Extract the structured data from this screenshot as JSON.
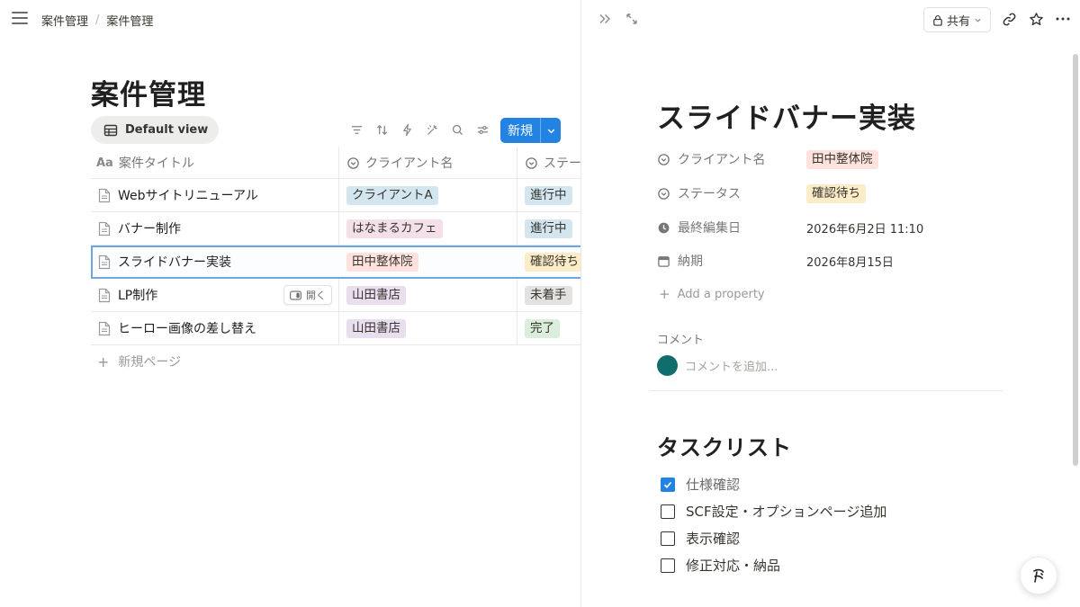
{
  "topbar": {
    "breadcrumb": [
      "案件管理",
      "案件管理"
    ]
  },
  "database": {
    "title": "案件管理",
    "view_label": "Default view",
    "new_button": "新規",
    "columns": [
      "案件タイトル",
      "クライアント名",
      "ステー"
    ],
    "rows": [
      {
        "title": "Webサイトリニューアル",
        "client": "クライアントA",
        "client_color": "#d3e5ef",
        "status": "進行中",
        "status_color": "#d3e5ef"
      },
      {
        "title": "バナー制作",
        "client": "はなまるカフェ",
        "client_color": "#f5e0e9",
        "status": "進行中",
        "status_color": "#d3e5ef"
      },
      {
        "title": "スライドバナー実装",
        "client": "田中整体院",
        "client_color": "#ffe2dd",
        "status": "確認待ち",
        "status_color": "#fdecc8"
      },
      {
        "title": "LP制作",
        "client": "山田書店",
        "client_color": "#e8deee",
        "status": "未着手",
        "status_color": "#e3e2e0"
      },
      {
        "title": "ヒーロー画像の差し替え",
        "client": "山田書店",
        "client_color": "#e8deee",
        "status": "完了",
        "status_color": "#dbeddb"
      }
    ],
    "open_button": "開く",
    "new_page": "新規ページ"
  },
  "page": {
    "share_label": "共有",
    "title": "スライドバナー実装",
    "properties": [
      {
        "name": "クライアント名",
        "value": "田中整体院",
        "tag_color": "#ffe2dd"
      },
      {
        "name": "ステータス",
        "value": "確認待ち",
        "tag_color": "#fdecc8"
      },
      {
        "name": "最終編集日",
        "value": "2026年6月2日 11:10"
      },
      {
        "name": "納期",
        "value": "2026年8月15日"
      }
    ],
    "add_property": "Add a property",
    "comment_label": "コメント",
    "comment_placeholder": "コメントを追加...",
    "tasklist_heading": "タスクリスト",
    "tasks": [
      {
        "label": "仕様確認",
        "checked": true
      },
      {
        "label": "SCF設定・オプションページ追加",
        "checked": false
      },
      {
        "label": "表示確認",
        "checked": false
      },
      {
        "label": "修正対応・納品",
        "checked": false
      }
    ]
  },
  "colors": {
    "accent": "#2383e2",
    "avatar": "#0f6e6b"
  }
}
